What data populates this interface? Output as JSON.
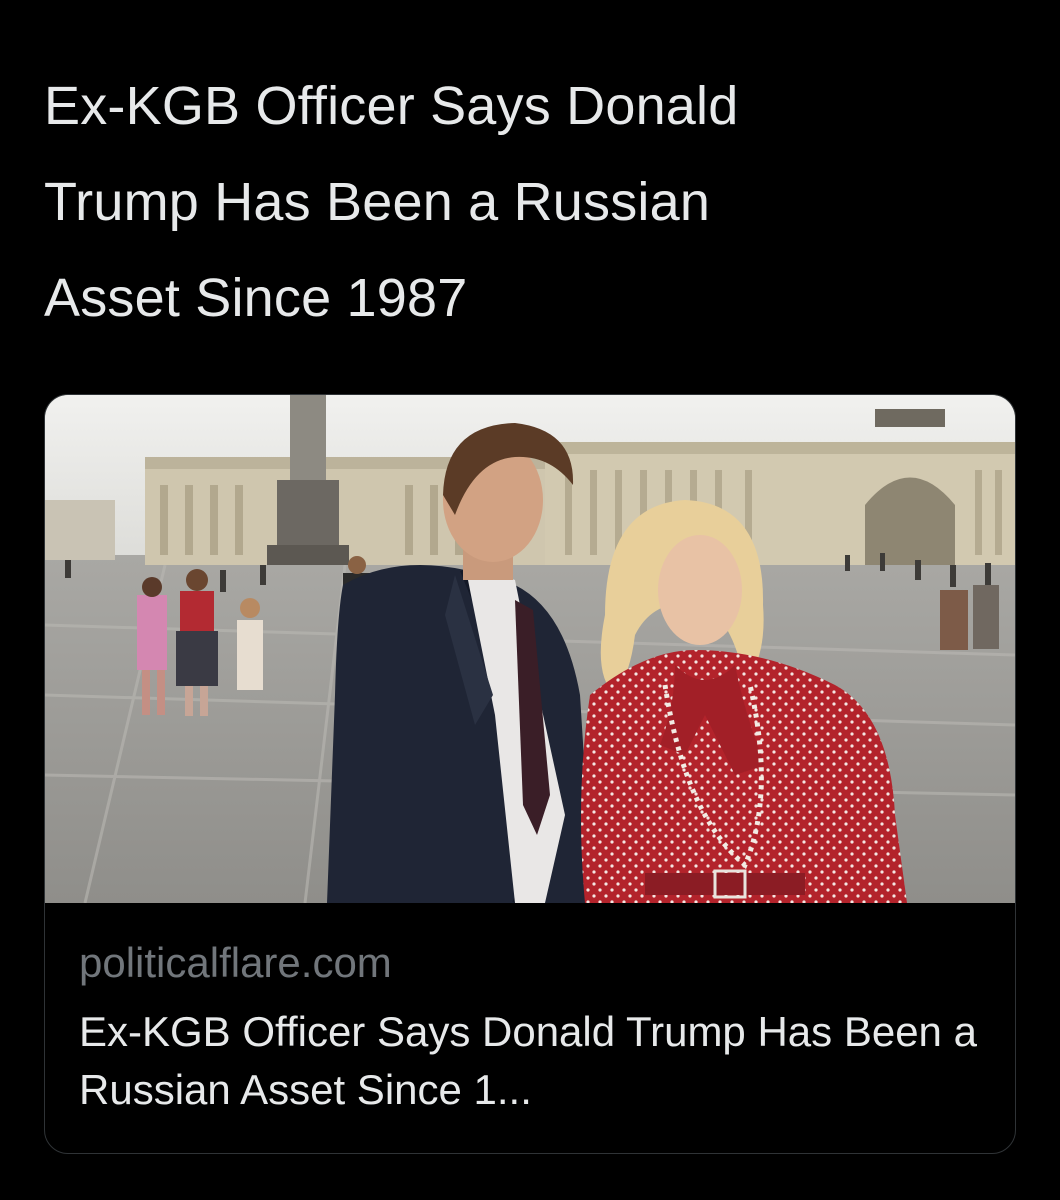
{
  "tweet": {
    "text": "Ex-KGB Officer Says Donald\nTrump Has Been a Russian\nAsset Since 1987"
  },
  "link_card": {
    "domain": "politicalflare.com",
    "title": "Ex-KGB Officer Says Donald Trump Has Been a Russian Asset Since 1..."
  },
  "colors": {
    "background": "#000000",
    "primary_text": "#e7e9ea",
    "secondary_text": "#71767b",
    "card_border": "#2f3336"
  }
}
